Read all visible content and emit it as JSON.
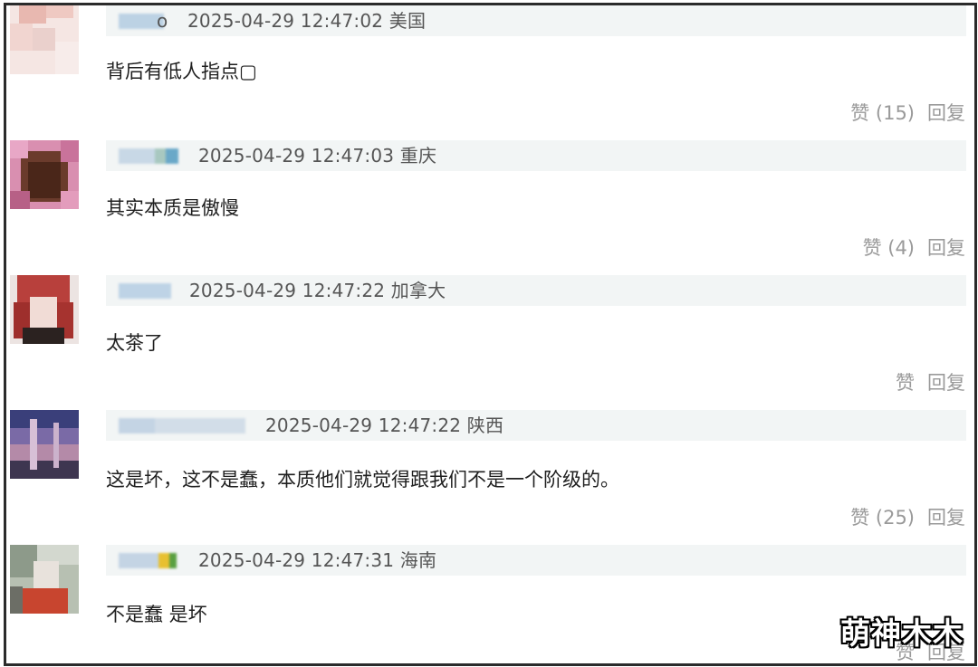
{
  "comments": [
    {
      "time_location": "2025-04-29 12:47:02 美国",
      "text": "背后有低人指点▢",
      "like_label": "赞",
      "like_count": "(15)",
      "reply_label": "回复",
      "username_tail": "o"
    },
    {
      "time_location": "2025-04-29 12:47:03 重庆",
      "text": "其实本质是傲慢",
      "like_label": "赞",
      "like_count": "(4)",
      "reply_label": "回复"
    },
    {
      "time_location": "2025-04-29 12:47:22 加拿大",
      "text": "太茶了",
      "like_label": "赞",
      "like_count": "",
      "reply_label": "回复"
    },
    {
      "time_location": "2025-04-29 12:47:22 陕西",
      "text": "这是坏，这不是蠢，本质他们就觉得跟我们不是一个阶级的。",
      "like_label": "赞",
      "like_count": "(25)",
      "reply_label": "回复"
    },
    {
      "time_location": "2025-04-29 12:47:31 海南",
      "text": "不是蠢 是坏",
      "like_label": "赞",
      "like_count": "",
      "reply_label": "回复"
    }
  ],
  "watermark": "萌神木木",
  "colors": {
    "header_bg": "#f2f5f5",
    "meta_text": "#555555",
    "action_text": "#9a9a9a",
    "frame_border": "#2b2b2b"
  }
}
